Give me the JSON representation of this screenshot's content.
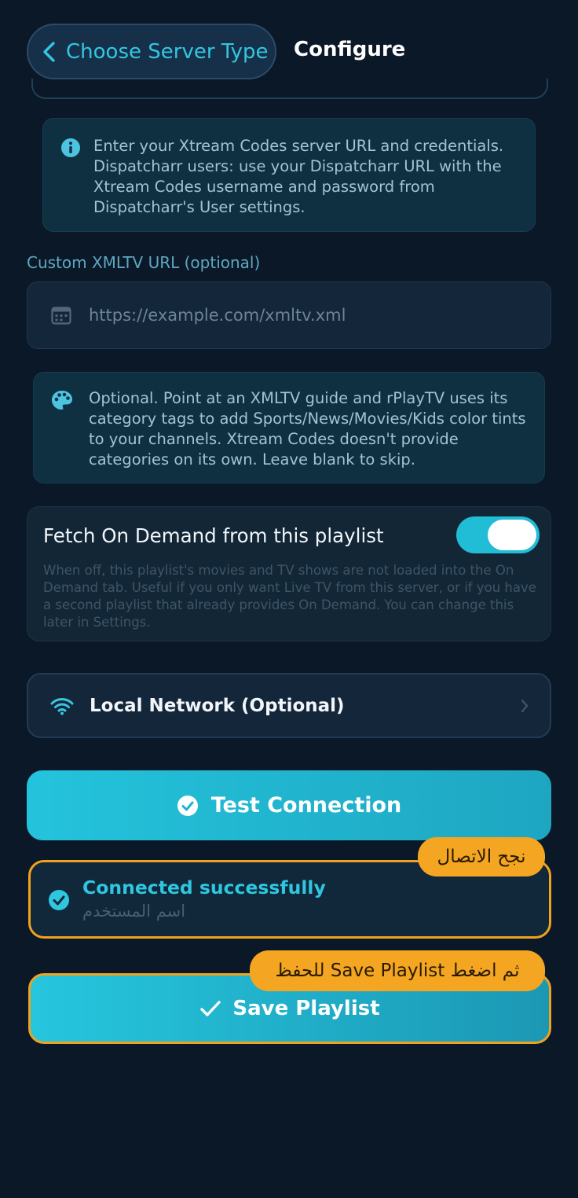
{
  "header": {
    "back_label": "Choose Server Type",
    "title": "Configure"
  },
  "xtream_info": {
    "icon": "info-icon",
    "text": "Enter your Xtream Codes server URL and credentials. Dispatcharr users: use your Dispatcharr URL with the Xtream Codes username and password from Dispatcharr's User settings."
  },
  "xmltv": {
    "label": "Custom XMLTV URL (optional)",
    "placeholder": "https://example.com/xmltv.xml",
    "value": "",
    "icon": "calendar-icon"
  },
  "xmltv_info": {
    "icon": "palette-icon",
    "text": "Optional. Point at an XMLTV guide and rPlayTV uses its category tags to add Sports/News/Movies/Kids color tints to your channels. Xtream Codes doesn't provide categories on its own. Leave blank to skip."
  },
  "on_demand": {
    "title": "Fetch On Demand from this playlist",
    "enabled": true,
    "description": "When off, this playlist's movies and TV shows are not loaded into the On Demand tab. Useful if you only want Live TV from this server, or if you have a second playlist that already provides On Demand. You can change this later in Settings."
  },
  "local_network": {
    "label": "Local Network (Optional)",
    "icon": "wifi-icon"
  },
  "test_connection": {
    "label": "Test Connection"
  },
  "connection_status": {
    "title": "Connected successfully",
    "subtitle": "اسم المستخدم"
  },
  "save": {
    "label": "Save Playlist"
  },
  "annotations": {
    "connected_note": "نجح الاتصال",
    "save_note": "ثم اضغط Save Playlist للحفظ"
  },
  "colors": {
    "background": "#0b1828",
    "accent": "#24c3dc",
    "highlight": "#f0a21e"
  }
}
